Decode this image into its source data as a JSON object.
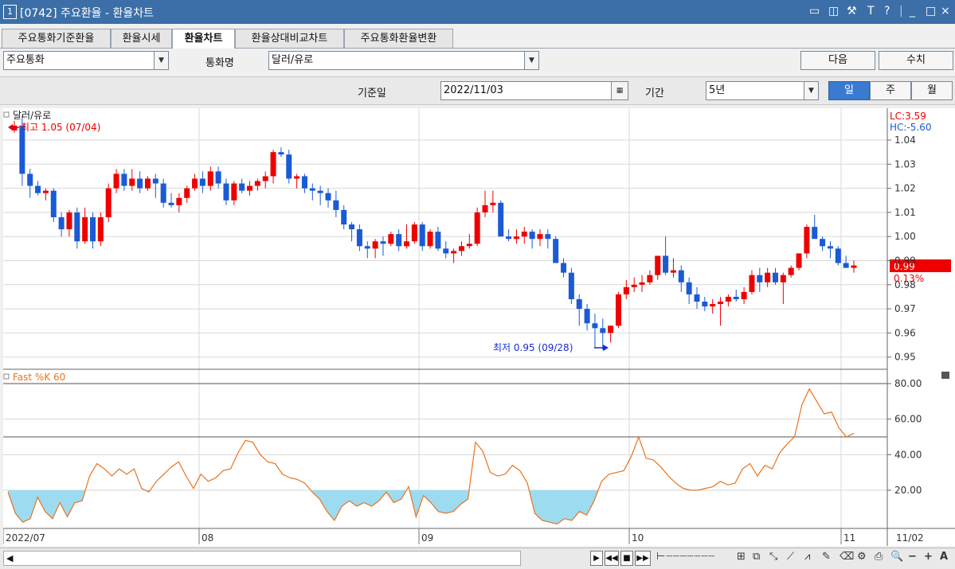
{
  "window": {
    "number": "1",
    "title": "[0742] 주요환율 - 환율차트",
    "controls": [
      "▭",
      "◫",
      "⚒",
      "T",
      "?",
      "|",
      "_",
      "□",
      "×"
    ]
  },
  "tabs": [
    {
      "label": "주요통화기준환율"
    },
    {
      "label": "환율시세"
    },
    {
      "label": "환율차트"
    },
    {
      "label": "환율상대비교차트"
    },
    {
      "label": "주요통화환율변환"
    }
  ],
  "toolbar": {
    "category_value": "주요통화",
    "currency_label": "통화명",
    "currency_value": "달러/유로",
    "next_button": "다음",
    "value_button": "수치",
    "base_date_label": "기준일",
    "base_date_value": "2022/11/03",
    "period_label": "기간",
    "period_value": "5년",
    "freq": [
      "일",
      "주",
      "월"
    ],
    "freq_selected": "일"
  },
  "chart_data": [
    {
      "type": "candlestick",
      "title": "달러/유로",
      "annotations": {
        "high": "최고 1.05 (07/04)",
        "low": "최저 0.95 (09/28)",
        "lc": "LC:3.59",
        "hc": "HC:-5.60",
        "last_price": "0.99",
        "last_change": "0.13%"
      },
      "y_ticks": [
        "1.04",
        "1.03",
        "1.02",
        "1.01",
        "1.00",
        "0.99",
        "0.98",
        "0.97",
        "0.96",
        "0.95"
      ],
      "ylim": [
        0.945,
        1.05
      ],
      "candles": [
        [
          1.044,
          1.048,
          1.043,
          1.046
        ],
        [
          1.046,
          1.05,
          1.021,
          1.026
        ],
        [
          1.026,
          1.028,
          1.016,
          1.021
        ],
        [
          1.021,
          1.023,
          1.017,
          1.018
        ],
        [
          1.018,
          1.02,
          1.015,
          1.019
        ],
        [
          1.019,
          1.02,
          1.006,
          1.008
        ],
        [
          1.008,
          1.01,
          1.0,
          1.003
        ],
        [
          1.003,
          1.011,
          1.0,
          1.01
        ],
        [
          1.01,
          1.012,
          0.995,
          0.998
        ],
        [
          0.998,
          1.012,
          0.997,
          1.008
        ],
        [
          1.008,
          1.01,
          0.995,
          0.998
        ],
        [
          0.998,
          1.01,
          0.996,
          1.008
        ],
        [
          1.008,
          1.022,
          1.006,
          1.02
        ],
        [
          1.02,
          1.028,
          1.018,
          1.026
        ],
        [
          1.026,
          1.028,
          1.019,
          1.021
        ],
        [
          1.021,
          1.028,
          1.019,
          1.024
        ],
        [
          1.024,
          1.027,
          1.018,
          1.02
        ],
        [
          1.02,
          1.025,
          1.019,
          1.024
        ],
        [
          1.024,
          1.026,
          1.016,
          1.022
        ],
        [
          1.022,
          1.024,
          1.012,
          1.014
        ],
        [
          1.014,
          1.018,
          1.012,
          1.013
        ],
        [
          1.013,
          1.018,
          1.01,
          1.016
        ],
        [
          1.016,
          1.021,
          1.014,
          1.02
        ],
        [
          1.02,
          1.026,
          1.019,
          1.024
        ],
        [
          1.024,
          1.027,
          1.018,
          1.021
        ],
        [
          1.021,
          1.029,
          1.019,
          1.027
        ],
        [
          1.027,
          1.029,
          1.02,
          1.022
        ],
        [
          1.022,
          1.024,
          1.013,
          1.015
        ],
        [
          1.015,
          1.023,
          1.013,
          1.022
        ],
        [
          1.022,
          1.024,
          1.018,
          1.019
        ],
        [
          1.019,
          1.023,
          1.017,
          1.021
        ],
        [
          1.021,
          1.024,
          1.019,
          1.023
        ],
        [
          1.023,
          1.027,
          1.02,
          1.025
        ],
        [
          1.025,
          1.036,
          1.022,
          1.035
        ],
        [
          1.035,
          1.037,
          1.033,
          1.034
        ],
        [
          1.034,
          1.036,
          1.022,
          1.024
        ],
        [
          1.024,
          1.026,
          1.02,
          1.025
        ],
        [
          1.025,
          1.026,
          1.018,
          1.02
        ],
        [
          1.02,
          1.022,
          1.015,
          1.019
        ],
        [
          1.019,
          1.021,
          1.013,
          1.018
        ],
        [
          1.018,
          1.02,
          1.012,
          1.015
        ],
        [
          1.015,
          1.019,
          1.008,
          1.011
        ],
        [
          1.011,
          1.013,
          1.003,
          1.005
        ],
        [
          1.005,
          1.006,
          0.998,
          1.003
        ],
        [
          1.003,
          1.005,
          0.994,
          0.996
        ],
        [
          0.996,
          0.998,
          0.991,
          0.995
        ],
        [
          0.995,
          0.999,
          0.991,
          0.998
        ],
        [
          0.998,
          1.0,
          0.992,
          0.997
        ],
        [
          0.997,
          1.002,
          0.996,
          1.001
        ],
        [
          1.001,
          1.003,
          0.994,
          0.996
        ],
        [
          0.996,
          1.005,
          0.995,
          0.998
        ],
        [
          0.998,
          1.006,
          0.997,
          1.005
        ],
        [
          1.005,
          1.006,
          0.994,
          0.996
        ],
        [
          0.996,
          1.003,
          0.995,
          1.002
        ],
        [
          1.002,
          1.004,
          0.994,
          0.995
        ],
        [
          0.995,
          0.998,
          0.991,
          0.993
        ],
        [
          0.993,
          0.995,
          0.989,
          0.994
        ],
        [
          0.994,
          0.998,
          0.992,
          0.996
        ],
        [
          0.996,
          1.001,
          0.995,
          0.997
        ],
        [
          0.997,
          1.012,
          0.996,
          1.01
        ],
        [
          1.01,
          1.019,
          1.008,
          1.013
        ],
        [
          1.013,
          1.019,
          1.01,
          1.014
        ],
        [
          1.014,
          1.015,
          1.0,
          1.0
        ],
        [
          1.0,
          1.003,
          0.998,
          0.999
        ],
        [
          0.999,
          1.003,
          0.997,
          1.0
        ],
        [
          1.0,
          1.004,
          0.997,
          1.002
        ],
        [
          1.002,
          1.003,
          0.995,
          0.999
        ],
        [
          0.999,
          1.003,
          0.996,
          1.001
        ],
        [
          1.001,
          1.003,
          0.995,
          0.999
        ],
        [
          0.999,
          1.0,
          0.991,
          0.989
        ],
        [
          0.989,
          0.991,
          0.983,
          0.985
        ],
        [
          0.985,
          0.987,
          0.972,
          0.974
        ],
        [
          0.974,
          0.976,
          0.963,
          0.97
        ],
        [
          0.97,
          0.972,
          0.961,
          0.964
        ],
        [
          0.964,
          0.968,
          0.954,
          0.962
        ],
        [
          0.962,
          0.966,
          0.953,
          0.96
        ],
        [
          0.96,
          0.963,
          0.956,
          0.963
        ],
        [
          0.963,
          0.977,
          0.962,
          0.976
        ],
        [
          0.976,
          0.982,
          0.974,
          0.979
        ],
        [
          0.979,
          0.983,
          0.977,
          0.98
        ],
        [
          0.98,
          0.984,
          0.977,
          0.981
        ],
        [
          0.981,
          0.986,
          0.98,
          0.984
        ],
        [
          0.984,
          0.992,
          0.982,
          0.992
        ],
        [
          0.992,
          1.0,
          0.984,
          0.985
        ],
        [
          0.985,
          0.991,
          0.983,
          0.986
        ],
        [
          0.986,
          0.988,
          0.977,
          0.981
        ],
        [
          0.981,
          0.983,
          0.972,
          0.976
        ],
        [
          0.976,
          0.979,
          0.97,
          0.973
        ],
        [
          0.973,
          0.975,
          0.969,
          0.971
        ],
        [
          0.971,
          0.974,
          0.968,
          0.972
        ],
        [
          0.972,
          0.975,
          0.963,
          0.973
        ],
        [
          0.973,
          0.976,
          0.971,
          0.975
        ],
        [
          0.975,
          0.978,
          0.973,
          0.974
        ],
        [
          0.974,
          0.979,
          0.972,
          0.977
        ],
        [
          0.977,
          0.986,
          0.976,
          0.984
        ],
        [
          0.984,
          0.987,
          0.977,
          0.981
        ],
        [
          0.981,
          0.987,
          0.979,
          0.985
        ],
        [
          0.985,
          0.987,
          0.98,
          0.981
        ],
        [
          0.981,
          0.985,
          0.972,
          0.984
        ],
        [
          0.984,
          0.988,
          0.983,
          0.987
        ],
        [
          0.987,
          0.993,
          0.986,
          0.993
        ],
        [
          0.993,
          1.005,
          0.991,
          1.004
        ],
        [
          1.004,
          1.009,
          0.999,
          0.999
        ],
        [
          0.999,
          1.0,
          0.994,
          0.996
        ],
        [
          0.996,
          0.998,
          0.991,
          0.995
        ],
        [
          0.995,
          0.996,
          0.988,
          0.989
        ],
        [
          0.989,
          0.992,
          0.987,
          0.987
        ],
        [
          0.987,
          0.99,
          0.985,
          0.988
        ]
      ]
    },
    {
      "type": "line",
      "title": "Fast %K 60",
      "y_ticks": [
        "80.00",
        "60.00",
        "40.00",
        "20.00"
      ],
      "ylim": [
        0,
        90
      ],
      "reference_lines": [
        80,
        50
      ],
      "fill_below": 20,
      "series": [
        {
          "name": "Fast %K 60",
          "values": [
            19,
            7,
            2,
            4,
            16,
            8,
            4,
            13,
            5,
            13,
            14,
            28,
            35,
            32,
            28,
            32,
            29,
            32,
            21,
            19,
            25,
            29,
            33,
            36,
            28,
            21,
            29,
            25,
            27,
            31,
            32,
            41,
            48,
            47,
            40,
            36,
            35,
            29,
            27,
            26,
            24,
            19,
            15,
            8,
            3,
            11,
            14,
            11,
            13,
            11,
            14,
            19,
            13,
            15,
            22,
            5,
            17,
            13,
            8,
            7,
            8,
            12,
            15,
            47,
            42,
            30,
            28,
            29,
            34,
            31,
            24,
            7,
            3,
            2,
            1,
            4,
            3,
            8,
            6,
            14,
            25,
            29,
            30,
            31,
            39,
            50,
            38,
            37,
            33,
            28,
            24,
            21,
            20,
            20,
            21,
            22,
            25,
            23,
            24,
            32,
            35,
            28,
            34,
            32,
            41,
            46,
            50,
            68,
            77,
            70,
            63,
            64,
            55,
            50,
            52
          ]
        }
      ],
      "x_labels": [
        "2022/07",
        "08",
        "09",
        "10",
        "11",
        "11/02"
      ]
    }
  ],
  "bottom": {
    "scroll_label": "◀",
    "buttons": [
      "▶",
      "◀◀",
      "■",
      "▶▶"
    ]
  }
}
